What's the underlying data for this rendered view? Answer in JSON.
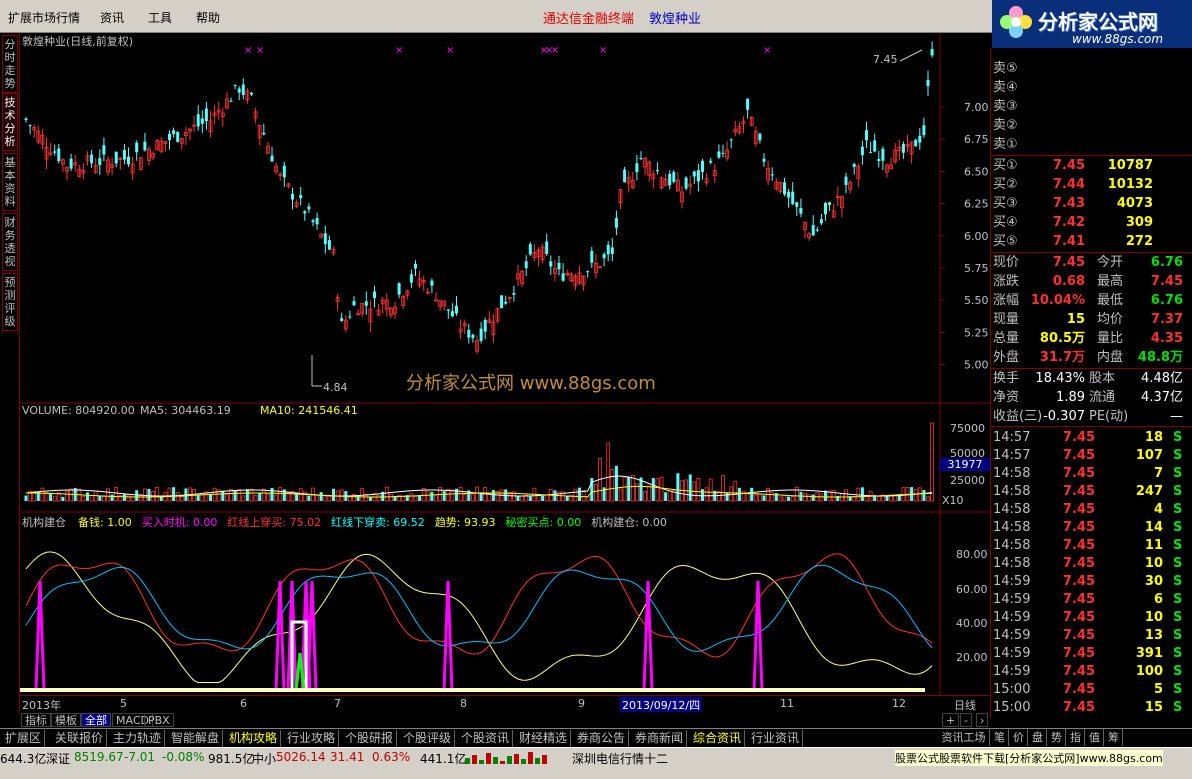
{
  "menu": [
    "扩展市场行情",
    "资讯",
    "工具",
    "帮助"
  ],
  "app_title": "通达信金融终端",
  "stock_name": "敦煌种业",
  "logo": {
    "name": "分析家公式网",
    "url": "www.88gs.com"
  },
  "left_tabs": [
    "分时走势",
    "技术分析",
    "基本资料",
    "财务透视",
    "预测评级"
  ],
  "kline": {
    "title": "敦煌种业(日线,前复权)",
    "price_axis": [
      "7.00",
      "6.75",
      "6.50",
      "6.25",
      "6.00",
      "5.75",
      "5.50",
      "5.25",
      "5.00"
    ],
    "high_label": "7.45",
    "low_label": "4.84",
    "watermark": "分析家公式网 www.88gs.com"
  },
  "volume": {
    "label": "VOLUME: 804920.00",
    "ma5": "MA5: 304463.19",
    "ma10": "MA10: 241546.41",
    "axis": [
      "75000",
      "50000",
      "25000"
    ],
    "current": "31977",
    "unit": "X10"
  },
  "indicator": {
    "name": "机构建仓",
    "items": [
      {
        "label": "备钱: 1.00",
        "color": "#ffff00"
      },
      {
        "label": "买入时机: 0.00",
        "color": "#ff00ff"
      },
      {
        "label": "红线上穿买: 75.02",
        "color": "#ff3030"
      },
      {
        "label": "红线下穿卖: 69.52",
        "color": "#00ffff"
      },
      {
        "label": "趋势: 93.93",
        "color": "#ffff00"
      },
      {
        "label": "秘密买点: 0.00",
        "color": "#00ff00"
      },
      {
        "label": "机构建仓: 0.00",
        "color": "#c0c0c0"
      }
    ],
    "axis": [
      "80.00",
      "60.00",
      "40.00",
      "20.00"
    ]
  },
  "date_axis": {
    "labels": [
      "2013年",
      "5",
      "6",
      "7",
      "8",
      "9",
      "2013/09/12/四",
      "11",
      "12"
    ],
    "period": "日线"
  },
  "sub_tabs": [
    "指标",
    "模板",
    "全部",
    "MACD",
    "PBX"
  ],
  "order_book": {
    "sell": [
      "卖⑤",
      "卖④",
      "卖③",
      "卖②",
      "卖①"
    ],
    "buy": [
      {
        "label": "买①",
        "price": "7.45",
        "vol": "10787"
      },
      {
        "label": "买②",
        "price": "7.44",
        "vol": "10132"
      },
      {
        "label": "买③",
        "price": "7.43",
        "vol": "4073"
      },
      {
        "label": "买④",
        "price": "7.42",
        "vol": "309"
      },
      {
        "label": "买⑤",
        "price": "7.41",
        "vol": "272"
      }
    ]
  },
  "quote": [
    {
      "l1": "现价",
      "v1": "7.45",
      "l2": "今开",
      "v2": "6.76",
      "c1": "#ff3030",
      "c2": "#00e000"
    },
    {
      "l1": "涨跌",
      "v1": "0.68",
      "l2": "最高",
      "v2": "7.45",
      "c1": "#ff3030",
      "c2": "#ff3030"
    },
    {
      "l1": "涨幅",
      "v1": "10.04%",
      "l2": "最低",
      "v2": "6.76",
      "c1": "#ff3030",
      "c2": "#00e000"
    },
    {
      "l1": "现量",
      "v1": "15",
      "l2": "均价",
      "v2": "7.37",
      "c1": "#ffff00",
      "c2": "#ff3030"
    },
    {
      "l1": "总量",
      "v1": "80.5万",
      "l2": "量比",
      "v2": "4.35",
      "c1": "#ffff00",
      "c2": "#ff3030"
    },
    {
      "l1": "外盘",
      "v1": "31.7万",
      "l2": "内盘",
      "v2": "48.8万",
      "c1": "#ff3030",
      "c2": "#00e000"
    }
  ],
  "fundamentals": [
    {
      "l1": "换手",
      "v1": "18.43%",
      "l2": "股本",
      "v2": "4.48亿"
    },
    {
      "l1": "净资",
      "v1": "1.89",
      "l2": "流通",
      "v2": "4.37亿"
    },
    {
      "l1": "收益(三)",
      "v1": "-0.307",
      "l2": "PE(动)",
      "v2": "—"
    }
  ],
  "ticks": [
    {
      "t": "14:57",
      "p": "7.45",
      "v": "18",
      "s": "S"
    },
    {
      "t": "14:57",
      "p": "7.45",
      "v": "107",
      "s": "S"
    },
    {
      "t": "14:58",
      "p": "7.45",
      "v": "7",
      "s": "S"
    },
    {
      "t": "14:58",
      "p": "7.45",
      "v": "247",
      "s": "S"
    },
    {
      "t": "14:58",
      "p": "7.45",
      "v": "4",
      "s": "S"
    },
    {
      "t": "14:58",
      "p": "7.45",
      "v": "14",
      "s": "S"
    },
    {
      "t": "14:58",
      "p": "7.45",
      "v": "11",
      "s": "S"
    },
    {
      "t": "14:58",
      "p": "7.45",
      "v": "10",
      "s": "S"
    },
    {
      "t": "14:59",
      "p": "7.45",
      "v": "30",
      "s": "S"
    },
    {
      "t": "14:59",
      "p": "7.45",
      "v": "6",
      "s": "S"
    },
    {
      "t": "14:59",
      "p": "7.45",
      "v": "10",
      "s": "S"
    },
    {
      "t": "14:59",
      "p": "7.45",
      "v": "13",
      "s": "S"
    },
    {
      "t": "14:59",
      "p": "7.45",
      "v": "391",
      "s": "S"
    },
    {
      "t": "14:59",
      "p": "7.45",
      "v": "100",
      "s": "S"
    },
    {
      "t": "15:00",
      "p": "7.45",
      "v": "5",
      "s": "S"
    },
    {
      "t": "15:00",
      "p": "7.45",
      "v": "15",
      "s": "S"
    }
  ],
  "right_tabs": [
    "资讯工场",
    "笔",
    "价",
    "盘",
    "势",
    "指",
    "值",
    "筹"
  ],
  "bottom_tabs": [
    "扩展区",
    "关联报价",
    "主力轨迹",
    "智能解盘",
    "机构攻略",
    "行业攻略",
    "个股研报",
    "个股评级",
    "个股资讯",
    "财经精选",
    "券商公告",
    "券商新闻",
    "综合资讯",
    "行业资讯"
  ],
  "status": {
    "sh_amount": "644.3亿",
    "sz_label": "深证",
    "sz_index": "8519.67",
    "sz_change": "-7.01",
    "sz_pct": "-0.08%",
    "sz_amount": "981.5亿",
    "zx_label": "中小",
    "zx_index": "5026.14",
    "zx_change": "31.41",
    "zx_pct": "0.63%",
    "zx_amount": "441.1亿",
    "server": "深圳电信行情十二",
    "ad": "股票公式股票软件下载[分析家公式网]www.88gs.com"
  }
}
